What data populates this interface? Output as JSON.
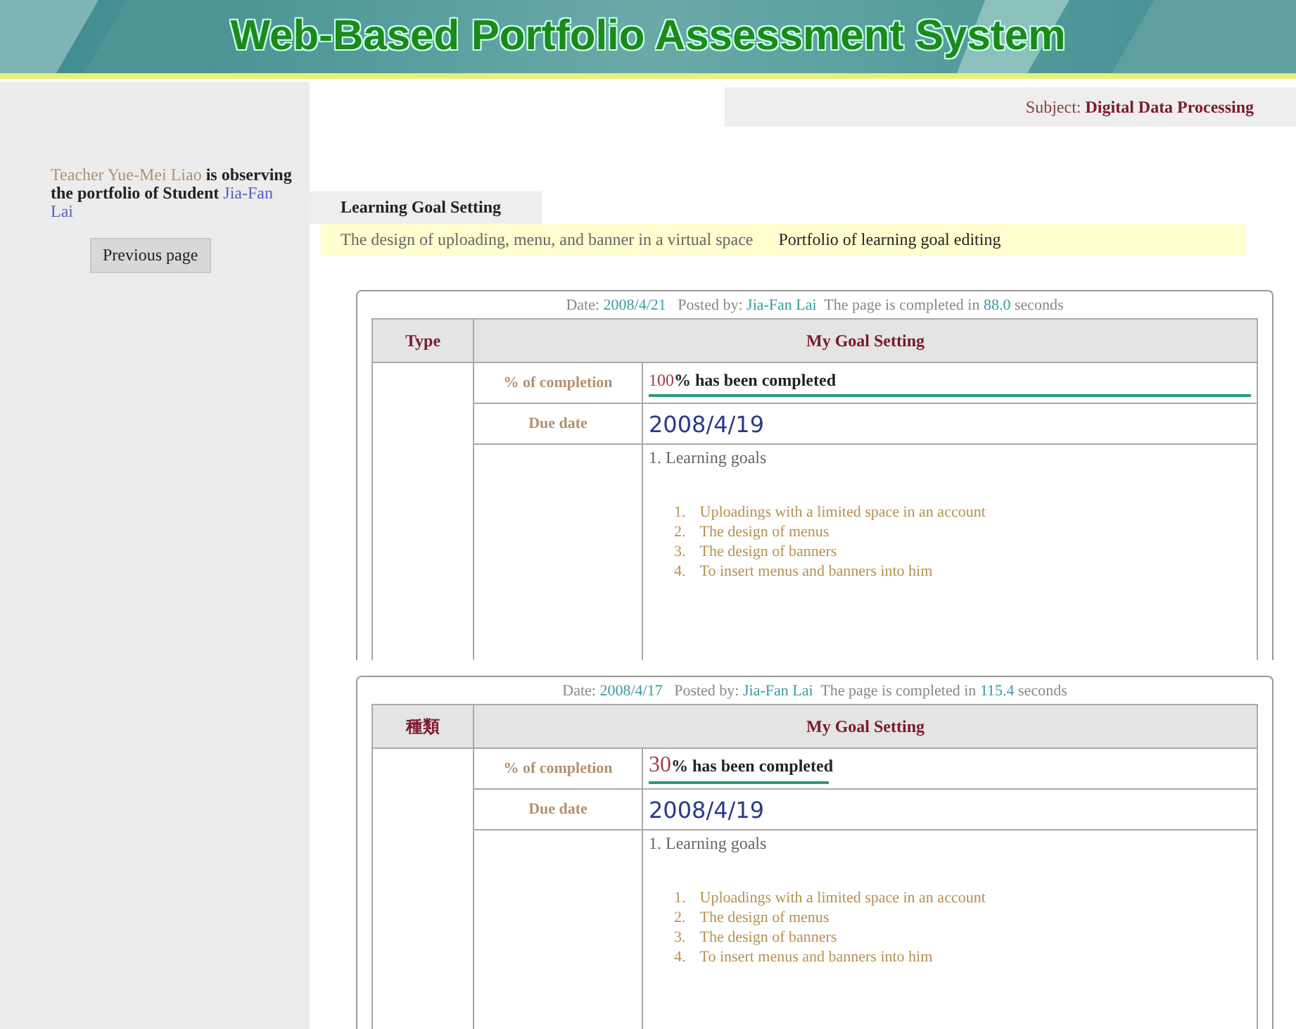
{
  "banner": {
    "title": "Web-Based Portfolio Assessment System"
  },
  "sidebar": {
    "note": {
      "teacher": "Teacher Yue-Mei Liao",
      "middle": "is observing the portfolio of",
      "student_label": "Student",
      "student": "Jia-Fan Lai"
    },
    "button": "Previous page"
  },
  "subject": {
    "label": "Subject:",
    "value": "Digital Data Processing"
  },
  "section_tab": "Learning Goal Setting",
  "breadcrumb": {
    "topic": "The design of uploading, menu, and banner in a virtual space",
    "page": "Portfolio of learning goal editing"
  },
  "entries": [
    {
      "date_label": "Date:",
      "date": "2008/4/21",
      "posted_label": "Posted by:",
      "author": "Jia-Fan Lai",
      "time_label": "The page is completed in",
      "seconds": "88.0",
      "seconds_label": "seconds",
      "type_header": "Type",
      "goal_header": "My Goal Setting",
      "completion_label": "% of completion",
      "completion_value": "100",
      "completion_text": "% has been completed",
      "level": 1,
      "due_label": "Due date",
      "due_date": "2008/4/19",
      "goals_heading": "1. Learning goals",
      "goals": [
        {
          "number": "1.",
          "text": "Uploadings with a limited space in an account"
        },
        {
          "number": "2.",
          "text": "The design of menus"
        },
        {
          "number": "3.",
          "text": "The design of banners"
        },
        {
          "number": "4.",
          "text": "To insert menus and banners into him"
        }
      ]
    },
    {
      "date_label": "Date:",
      "date": "2008/4/17",
      "posted_label": "Posted by:",
      "author": "Jia-Fan Lai",
      "time_label": "The page is completed in",
      "seconds": "115.4",
      "seconds_label": "seconds",
      "type_header": "種類",
      "goal_header": "My Goal Setting",
      "completion_label": "% of completion",
      "completion_value": "30",
      "completion_text": "% has been completed",
      "level": 0.3,
      "due_label": "Due date",
      "due_date": "2008/4/19",
      "goals_heading": "1. Learning goals",
      "goals": [
        {
          "number": "1.",
          "text": "Uploadings with a limited space in an account"
        },
        {
          "number": "2.",
          "text": "The design of menus"
        },
        {
          "number": "3.",
          "text": "The design of banners"
        },
        {
          "number": "4.",
          "text": "To insert menus and banners into him"
        }
      ]
    }
  ]
}
